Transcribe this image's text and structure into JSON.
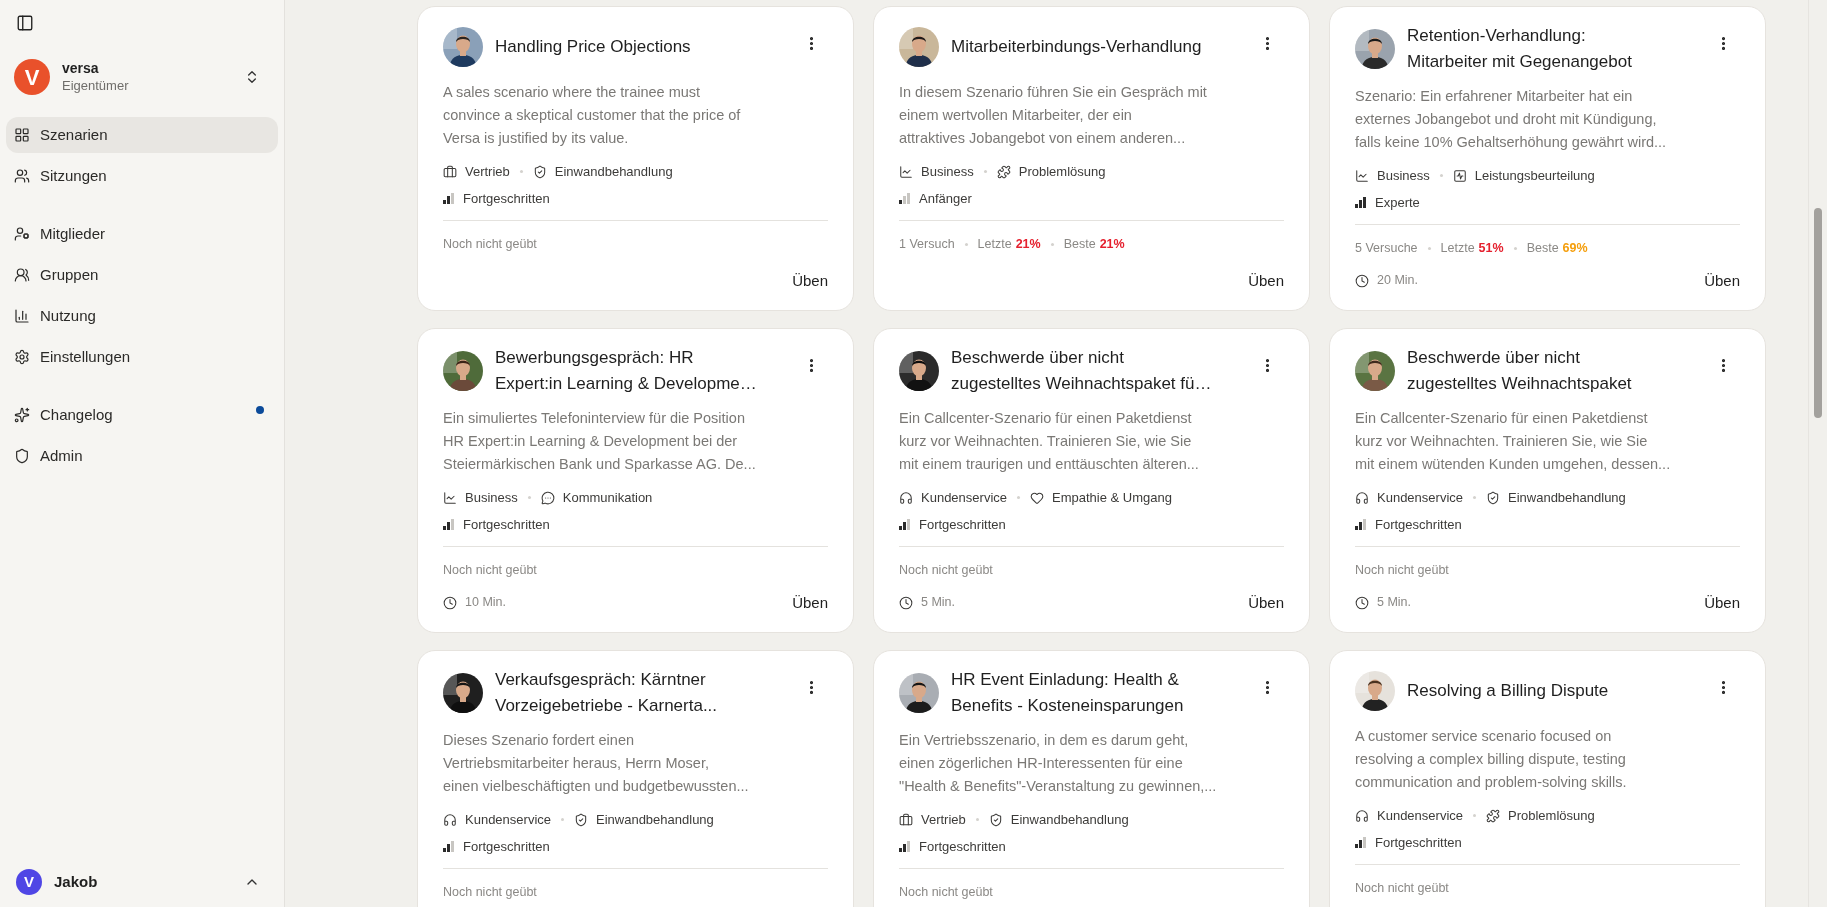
{
  "workspace": {
    "logo_letter": "V",
    "name": "versa",
    "role": "Eigentümer"
  },
  "nav_groups": [
    [
      {
        "label": "Szenarien",
        "kind": "grid",
        "selected": true,
        "dot": false
      },
      {
        "label": "Sitzungen",
        "kind": "users",
        "selected": false,
        "dot": false
      }
    ],
    [
      {
        "label": "Mitglieder",
        "kind": "user-cog",
        "selected": false,
        "dot": false
      },
      {
        "label": "Gruppen",
        "kind": "group",
        "selected": false,
        "dot": false
      },
      {
        "label": "Nutzung",
        "kind": "bars",
        "selected": false,
        "dot": false
      },
      {
        "label": "Einstellungen",
        "kind": "gear",
        "selected": false,
        "dot": false
      }
    ],
    [
      {
        "label": "Changelog",
        "kind": "sparkles",
        "selected": false,
        "dot": true
      },
      {
        "label": "Admin",
        "kind": "shield",
        "selected": false,
        "dot": false
      }
    ]
  ],
  "user": {
    "avatar_letter": "V",
    "name": "Jakob"
  },
  "scenarios": [
    {
      "title_lines": [
        "Handling Price Objections"
      ],
      "description_lines": [
        "A sales scenario where the trainee must",
        "convince a skeptical customer that the price of",
        "Versa is justified by its value."
      ],
      "tags": [
        {
          "kind": "briefcase",
          "label": "Vertrieb"
        },
        {
          "kind": "shield-check",
          "label": "Einwandbehandlung"
        }
      ],
      "difficulty": {
        "label": "Fortgeschritten",
        "bars": [
          {
            "filled": true
          },
          {
            "filled": true
          },
          {
            "filled": false
          }
        ]
      },
      "stats": {
        "empty": "Noch nicht geübt"
      },
      "action": "Üben"
    },
    {
      "title_lines": [
        "Mitarbeiterbindungs-Verhandlung"
      ],
      "description_lines": [
        "In diesem Szenario führen Sie ein Gespräch mit",
        "einem wertvollen Mitarbeiter, der ein",
        "attraktives Jobangebot von einem anderen..."
      ],
      "tags": [
        {
          "kind": "chart",
          "label": "Business"
        },
        {
          "kind": "puzzle",
          "label": "Problemlösung"
        }
      ],
      "difficulty": {
        "label": "Anfänger",
        "bars": [
          {
            "filled": true
          },
          {
            "filled": false
          },
          {
            "filled": false
          }
        ]
      },
      "stats": {
        "attempts": "1 Versuch",
        "scores": [
          {
            "label": "Letzte",
            "value": "21%",
            "color": "#e5202e"
          },
          {
            "label": "Beste",
            "value": "21%",
            "color": "#e5202e"
          }
        ]
      },
      "action": "Üben"
    },
    {
      "title_lines": [
        "Retention-Verhandlung:",
        "Mitarbeiter mit Gegenangebot"
      ],
      "description_lines": [
        "Szenario: Ein erfahrener Mitarbeiter hat ein",
        "externes Jobangebot und droht mit Kündigung,",
        "falls keine 10% Gehaltserhöhung gewährt wird..."
      ],
      "tags": [
        {
          "kind": "chart",
          "label": "Business"
        },
        {
          "kind": "review",
          "label": "Leistungsbeurteilung"
        }
      ],
      "difficulty": {
        "label": "Experte",
        "bars": [
          {
            "filled": true
          },
          {
            "filled": true
          },
          {
            "filled": true
          }
        ]
      },
      "stats": {
        "attempts": "5 Versuche",
        "scores": [
          {
            "label": "Letzte",
            "value": "51%",
            "color": "#e5202e"
          },
          {
            "label": "Beste",
            "value": "69%",
            "color": "#f59e0b"
          }
        ]
      },
      "duration": "20 Min.",
      "action": "Üben"
    },
    {
      "title_lines": [
        "Bewerbungsgespräch: HR",
        "Expert:in Learning & Developme…"
      ],
      "description_lines": [
        "Ein simuliertes Telefoninterview für die Position",
        "HR Expert:in Learning & Development bei der",
        "Steiermärkischen Bank und Sparkasse AG. De..."
      ],
      "tags": [
        {
          "kind": "chart",
          "label": "Business"
        },
        {
          "kind": "chat",
          "label": "Kommunikation"
        }
      ],
      "difficulty": {
        "label": "Fortgeschritten",
        "bars": [
          {
            "filled": true
          },
          {
            "filled": true
          },
          {
            "filled": false
          }
        ]
      },
      "stats": {
        "empty": "Noch nicht geübt"
      },
      "duration": "10 Min.",
      "action": "Üben"
    },
    {
      "title_lines": [
        "Beschwerde über nicht",
        "zugestelltes Weihnachtspaket fü…"
      ],
      "description_lines": [
        "Ein Callcenter-Szenario für einen Paketdienst",
        "kurz vor Weihnachten. Trainieren Sie, wie Sie",
        "mit einem traurigen und enttäuschten älteren..."
      ],
      "tags": [
        {
          "kind": "headphones",
          "label": "Kundenservice"
        },
        {
          "kind": "heart",
          "label": "Empathie & Umgang"
        }
      ],
      "difficulty": {
        "label": "Fortgeschritten",
        "bars": [
          {
            "filled": true
          },
          {
            "filled": true
          },
          {
            "filled": false
          }
        ]
      },
      "stats": {
        "empty": "Noch nicht geübt"
      },
      "duration": "5 Min.",
      "action": "Üben"
    },
    {
      "title_lines": [
        "Beschwerde über nicht",
        "zugestelltes Weihnachtspaket"
      ],
      "description_lines": [
        "Ein Callcenter-Szenario für einen Paketdienst",
        "kurz vor Weihnachten. Trainieren Sie, wie Sie",
        "mit einem wütenden Kunden umgehen, dessen..."
      ],
      "tags": [
        {
          "kind": "headphones",
          "label": "Kundenservice"
        },
        {
          "kind": "shield-check",
          "label": "Einwandbehandlung"
        }
      ],
      "difficulty": {
        "label": "Fortgeschritten",
        "bars": [
          {
            "filled": true
          },
          {
            "filled": true
          },
          {
            "filled": false
          }
        ]
      },
      "stats": {
        "empty": "Noch nicht geübt"
      },
      "duration": "5 Min.",
      "action": "Üben"
    },
    {
      "title_lines": [
        "Verkaufsgespräch: Kärntner",
        "Vorzeigebetriebe - Karnerta..."
      ],
      "description_lines": [
        "Dieses Szenario fordert einen",
        "Vertriebsmitarbeiter heraus, Herrn Moser,",
        "einen vielbeschäftigten und budgetbewussten..."
      ],
      "tags": [
        {
          "kind": "headphones",
          "label": "Kundenservice"
        },
        {
          "kind": "shield-check",
          "label": "Einwandbehandlung"
        }
      ],
      "difficulty": {
        "label": "Fortgeschritten",
        "bars": [
          {
            "filled": true
          },
          {
            "filled": true
          },
          {
            "filled": false
          }
        ]
      },
      "stats": {
        "empty": "Noch nicht geübt"
      }
    },
    {
      "title_lines": [
        "HR Event Einladung: Health &",
        "Benefits - Kosteneinsparungen"
      ],
      "description_lines": [
        "Ein Vertriebsszenario, in dem es darum geht,",
        "einen zögerlichen HR-Interessenten für eine",
        "\"Health & Benefits\"-Veranstaltung zu gewinnen,..."
      ],
      "tags": [
        {
          "kind": "briefcase",
          "label": "Vertrieb"
        },
        {
          "kind": "shield-check",
          "label": "Einwandbehandlung"
        }
      ],
      "difficulty": {
        "label": "Fortgeschritten",
        "bars": [
          {
            "filled": true
          },
          {
            "filled": true
          },
          {
            "filled": false
          }
        ]
      },
      "stats": {
        "empty": "Noch nicht geübt"
      }
    },
    {
      "title_lines": [
        "Resolving a Billing Dispute"
      ],
      "description_lines": [
        "A customer service scenario focused on",
        "resolving a complex billing dispute, testing",
        "communication and problem-solving skills."
      ],
      "tags": [
        {
          "kind": "headphones",
          "label": "Kundenservice"
        },
        {
          "kind": "puzzle",
          "label": "Problemlösung"
        }
      ],
      "difficulty": {
        "label": "Fortgeschritten",
        "bars": [
          {
            "filled": true
          },
          {
            "filled": true
          },
          {
            "filled": false
          }
        ]
      },
      "stats": {
        "empty": "Noch nicht geübt"
      }
    }
  ]
}
